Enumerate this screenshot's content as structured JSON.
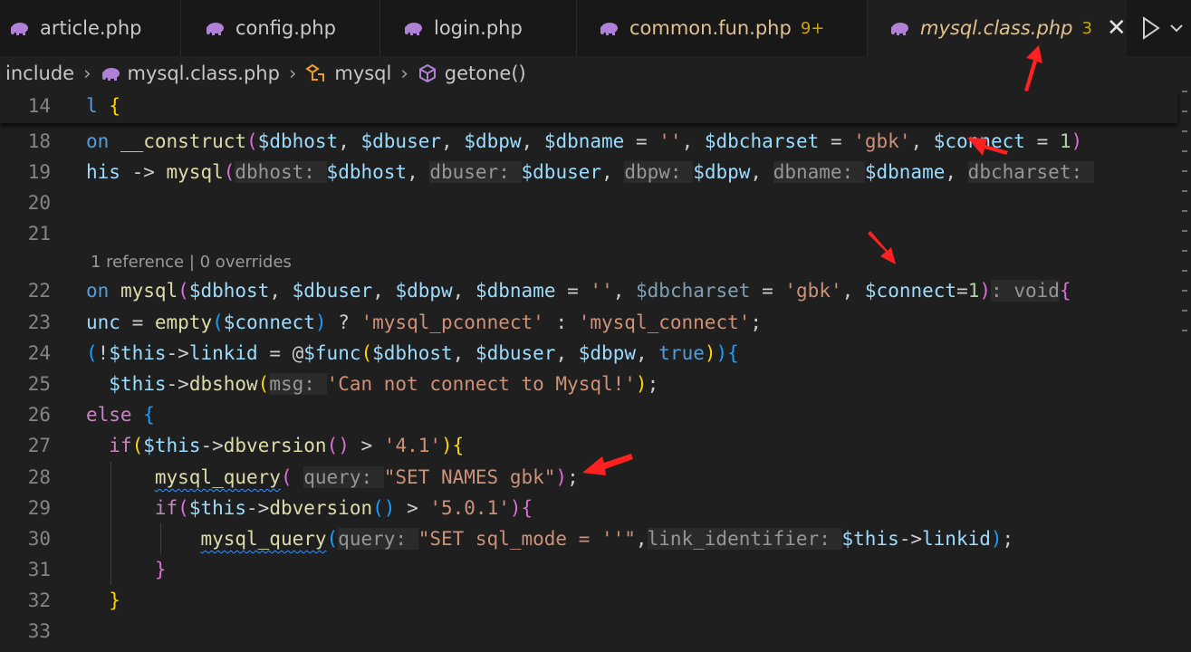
{
  "tabs": [
    {
      "label": "article.php",
      "badge": "",
      "active": false
    },
    {
      "label": "config.php",
      "badge": "",
      "active": false
    },
    {
      "label": "login.php",
      "badge": "",
      "active": false
    },
    {
      "label": "common.fun.php",
      "badge": "9+",
      "active": false
    },
    {
      "label": "mysql.class.php",
      "badge": "3",
      "active": true
    }
  ],
  "tab_close_glyph": "✕",
  "breadcrumb": {
    "folder": "include",
    "file": "mysql.class.php",
    "class": "mysql",
    "method": "getone()"
  },
  "editor": {
    "codelens": "1 reference | 0 overrides",
    "lines": [
      {
        "num": "14"
      },
      {
        "num": "18"
      },
      {
        "num": "19"
      },
      {
        "num": "20"
      },
      {
        "num": "21"
      },
      {
        "num": "22"
      },
      {
        "num": "23"
      },
      {
        "num": "24"
      },
      {
        "num": "25"
      },
      {
        "num": "26"
      },
      {
        "num": "27"
      },
      {
        "num": "28"
      },
      {
        "num": "29"
      },
      {
        "num": "30"
      },
      {
        "num": "31"
      },
      {
        "num": "32"
      },
      {
        "num": "33"
      }
    ]
  },
  "colors": {
    "background": "#1f1f1f",
    "tab_bar": "#181818",
    "active_tab_label": "#e2c08d",
    "badge": "#cca700",
    "annotation_arrow": "#ff2020"
  },
  "icons": [
    "php-elephant-icon",
    "close-icon",
    "run-icon",
    "chevron-down-icon",
    "class-icon",
    "method-cube-icon"
  ]
}
